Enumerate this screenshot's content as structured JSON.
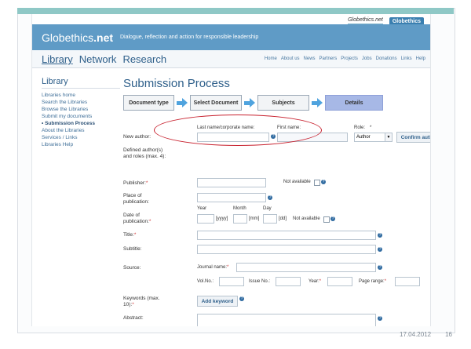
{
  "screen": {
    "logos": {
      "left_text": "Globethics.net",
      "right_text": "Globethics"
    },
    "header": {
      "brand_part1": "Globethics",
      "brand_part2": ".net",
      "tagline": "Dialogue, reflection and action for responsible leadership"
    },
    "nav": {
      "main": [
        "Library",
        "Network",
        "Research"
      ],
      "links": [
        "Home",
        "About us",
        "News",
        "Partners",
        "Projects",
        "Jobs",
        "Donations",
        "Links",
        "Help"
      ]
    },
    "sidebar": {
      "title": "Library",
      "items": [
        "Libraries home",
        "Search the Libraries",
        "Browse the Libraries",
        "Submit my documents",
        "• Submission Process",
        "About the Libraries",
        "Services / Links",
        "Libraries Help"
      ]
    },
    "main": {
      "title": "Submission Process",
      "steps": [
        "Document type",
        "Select Document",
        "Subjects",
        "Details"
      ],
      "form": {
        "author": {
          "label": "New author:",
          "lastname_label": "Last name/corporate name:",
          "firstname_label": "First name:",
          "role_label": "Role:",
          "role_value": "Author",
          "confirm_button": "Confirm authors",
          "defined_label": "Defined author(s) and roles (max. 4):"
        },
        "publisher": {
          "label": "Publisher:",
          "not_available": "Not available"
        },
        "place": {
          "label": "Place of publication:"
        },
        "date": {
          "label": "Date of publication:",
          "year": "Year",
          "month": "Month",
          "day": "Day",
          "yyyy": "[yyyy]",
          "mm": "[mm]",
          "dd": "[dd]",
          "not_available": "Not available"
        },
        "title": {
          "label": "Title:"
        },
        "subtitle": {
          "label": "Subtitle:"
        },
        "source": {
          "label": "Source:",
          "journal_name": "Journal name:",
          "vol_no": "Vol.No.:",
          "issue_no": "Issue No.:",
          "year": "Year:",
          "page_range": "Page range:"
        },
        "keywords": {
          "label": "Keywords (max. 10):",
          "button": "Add keyword"
        },
        "abstract": {
          "label": "Abstract:"
        }
      }
    }
  },
  "slide_footer": {
    "date": "17.04.2012",
    "page": "16"
  }
}
